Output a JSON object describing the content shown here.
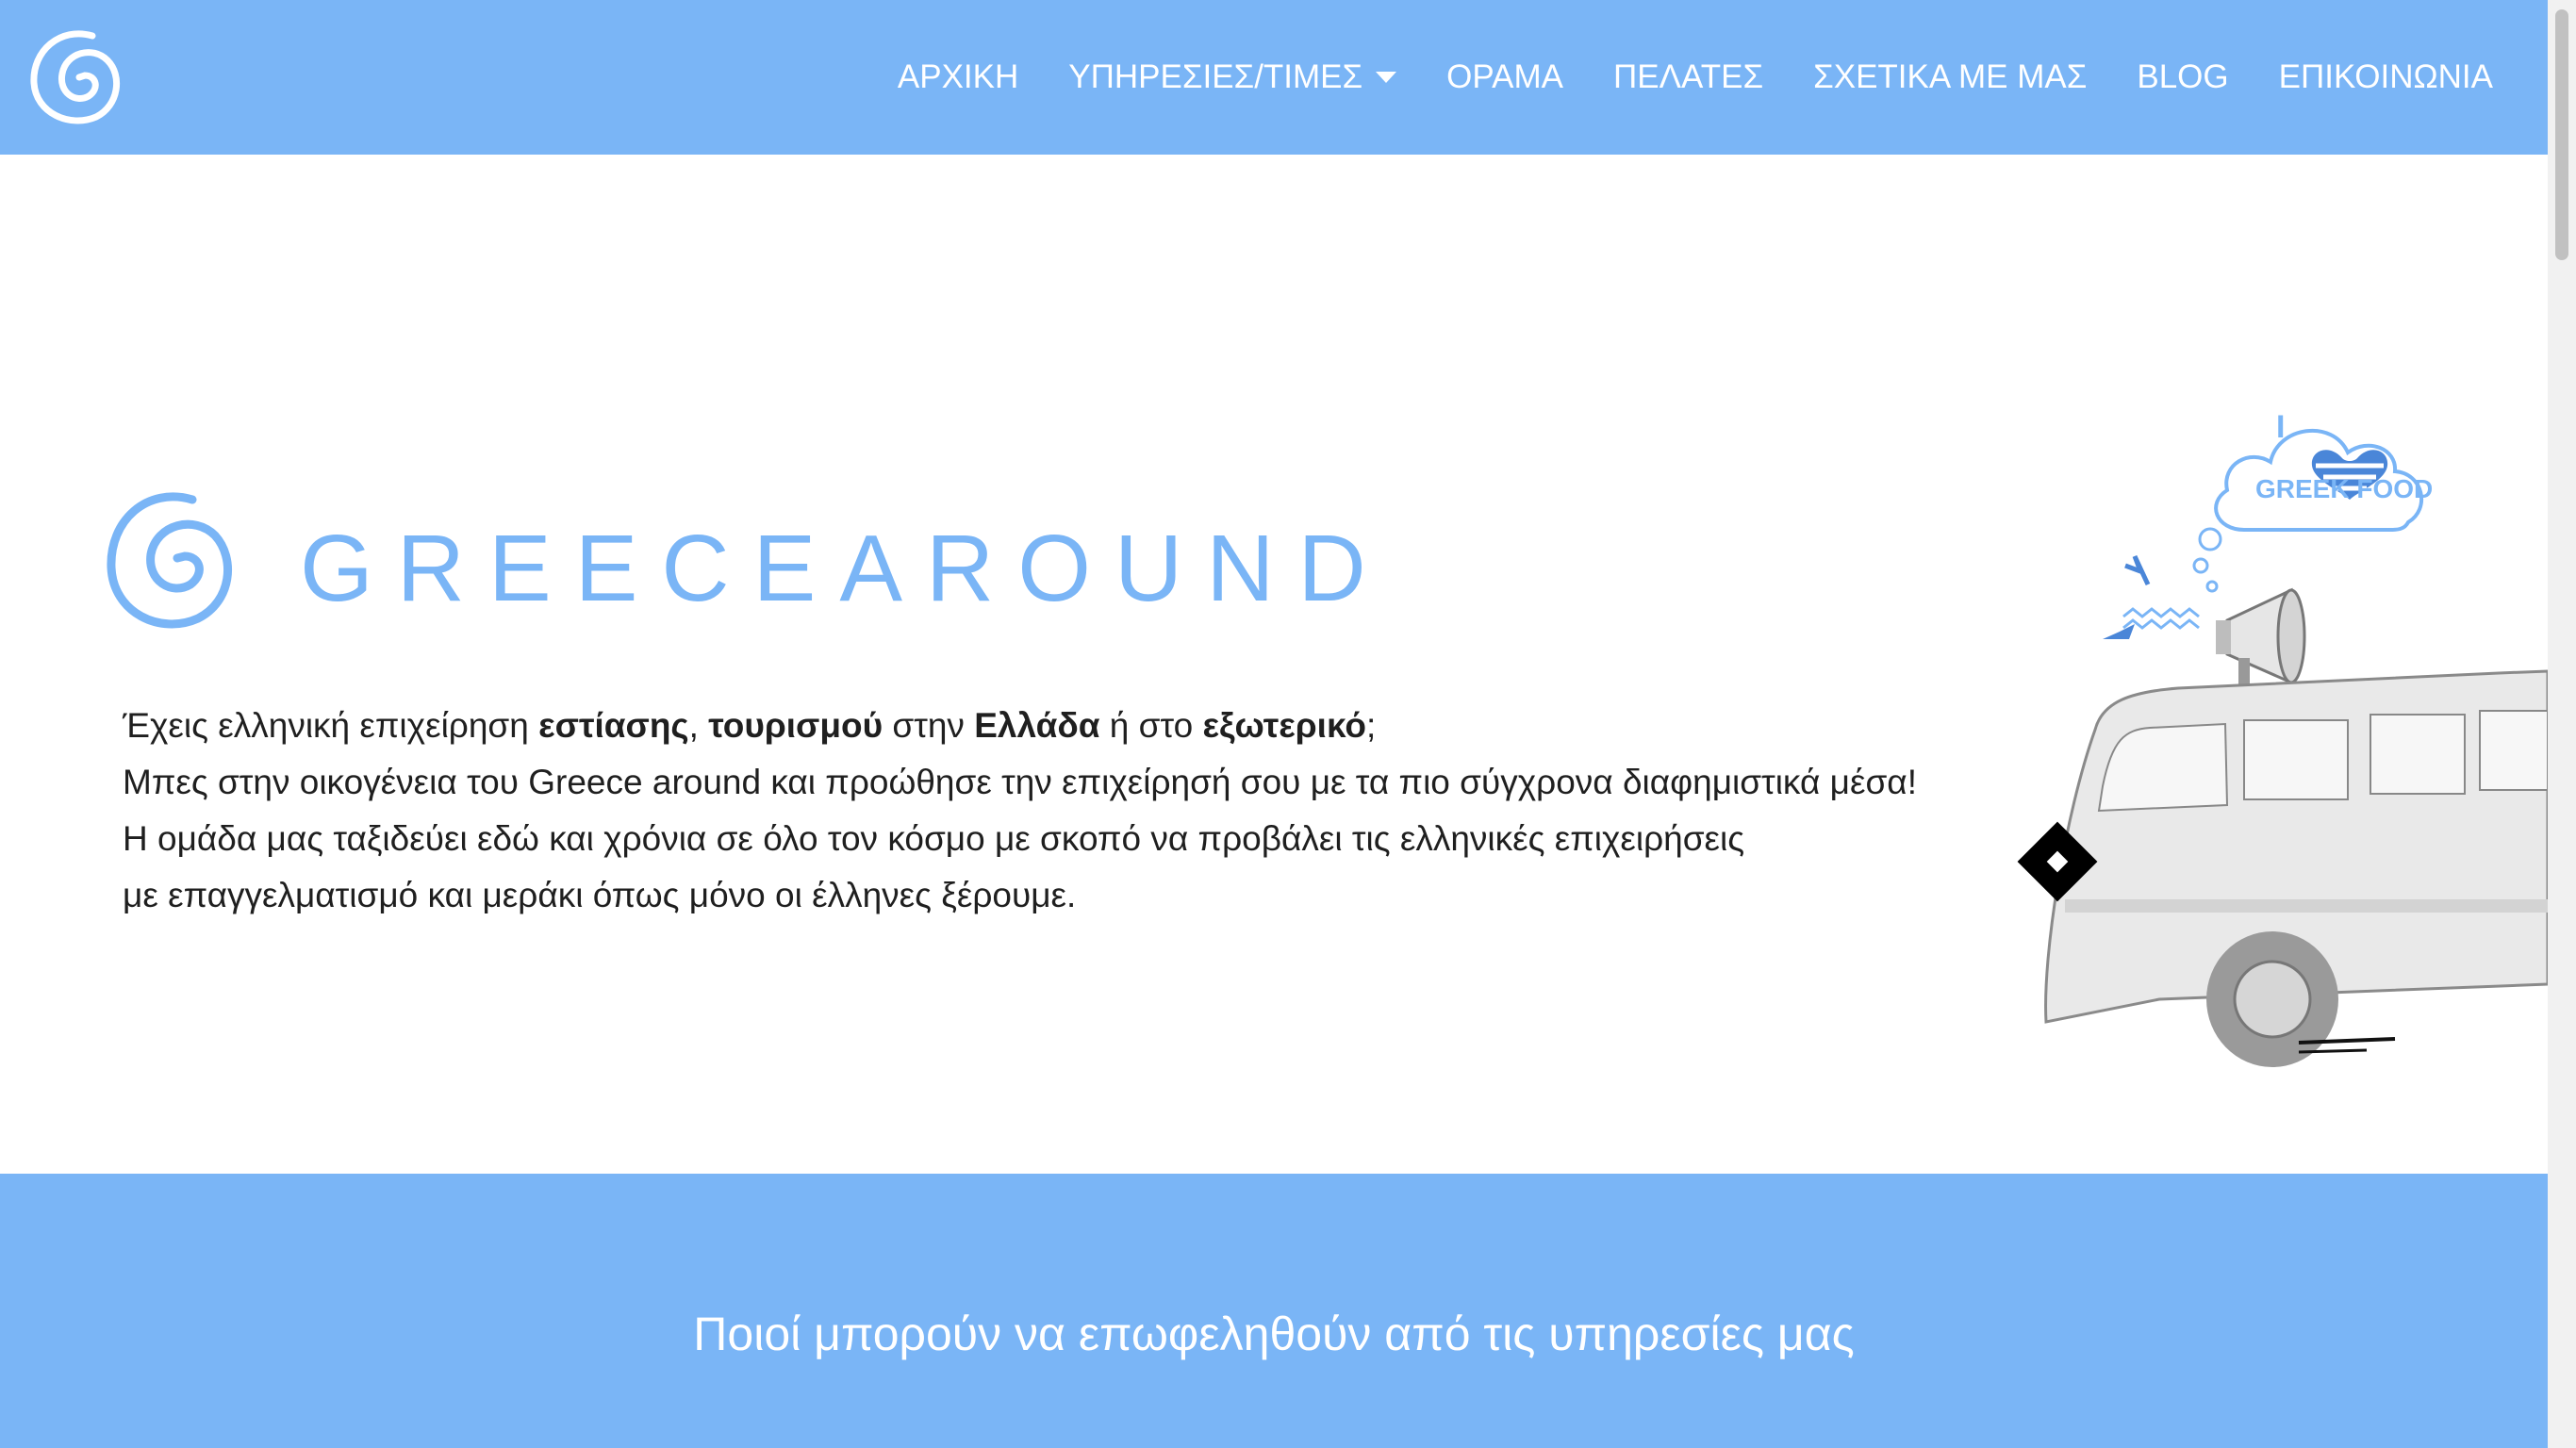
{
  "nav": {
    "items": [
      {
        "label": "ΑΡΧΙΚΗ"
      },
      {
        "label": "ΥΠΗΡΕΣΙΕΣ/ΤΙΜΕΣ"
      },
      {
        "label": "ΟΡΑΜΑ"
      },
      {
        "label": "ΠΕΛΑΤΕΣ"
      },
      {
        "label": "ΣΧΕΤΙΚΑ ΜΕ ΜΑΣ"
      },
      {
        "label": "BLOG"
      },
      {
        "label": "ΕΠΙΚΟΙΝΩΝΙΑ"
      }
    ]
  },
  "hero": {
    "brand": "GREECEAROUND",
    "line1": {
      "p1": "Έχεις ελληνική επιχείρηση ",
      "b1": "εστίασης",
      "p2": ", ",
      "b2": "τουρισμού",
      "p3": " στην ",
      "b3": "Ελλάδα",
      "p4": " ή στο ",
      "b4": "εξωτερικό",
      "p5": ";"
    },
    "line2": "Μπες στην οικογένεια του Greece around και προώθησε την επιχείρησή σου με τα πιο σύγχρονα διαφημιστικά μέσα!",
    "line3": "Η ομάδα μας ταξιδεύει εδώ και χρόνια σε όλο τον κόσμο με σκοπό να προβάλει τις ελληνικές επιχειρήσεις",
    "line4": "με επαγγελματισμό και μεράκι όπως μόνο οι έλληνες ξέρουμε.",
    "cloud_text_top": "I",
    "cloud_text": "GREEK FOOD"
  },
  "section": {
    "title": "Ποιοί μπορούν να επωφεληθούν από τις υπηρεσίες μας"
  },
  "colors": {
    "accent": "#7ab5f6",
    "text": "#1f1f1f"
  }
}
